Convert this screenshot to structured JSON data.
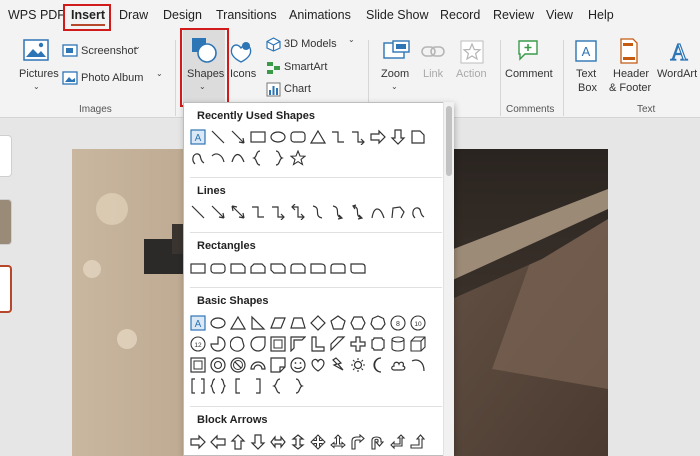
{
  "menubar": {
    "items": [
      "WPS PDF",
      "Insert",
      "Draw",
      "Design",
      "Transitions",
      "Animations",
      "Slide Show",
      "Record",
      "Review",
      "View",
      "Help"
    ],
    "active": "Insert"
  },
  "ribbon": {
    "images_group": {
      "pictures": "Pictures",
      "screenshot": "Screenshot",
      "photo_album": "Photo Album",
      "label": "Images"
    },
    "shapes": "Shapes",
    "icons": "Icons",
    "models_3d": "3D Models",
    "smartart": "SmartArt",
    "chart": "Chart",
    "zoom": "Zoom",
    "link": "Link",
    "action": "Action",
    "comment": "Comment",
    "comments_label": "Comments",
    "text_box_line1": "Text",
    "text_box_line2": "Box",
    "header_line1": "Header",
    "header_line2": "& Footer",
    "wordart": "WordArt",
    "text_label": "Text"
  },
  "shapes_menu": {
    "recently_used": "Recently Used Shapes",
    "lines": "Lines",
    "rectangles": "Rectangles",
    "basic_shapes": "Basic Shapes",
    "block_arrows": "Block Arrows"
  },
  "colors": {
    "accent": "#b7472a",
    "highlight_box": "#d11a1a",
    "icon_blue": "#2e75b6"
  }
}
